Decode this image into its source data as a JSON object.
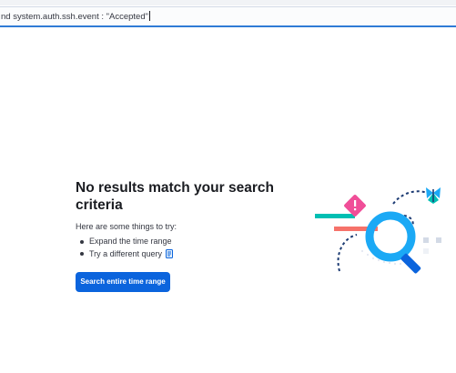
{
  "query_bar": {
    "value": "nd system.auth.ssh.event : \"Accepted\""
  },
  "empty_state": {
    "title": "No results match your search criteria",
    "lead": "Here are some things to try:",
    "tips": [
      "Expand the time range",
      "Try a different query"
    ],
    "button_label": "Search entire time range"
  },
  "colors": {
    "accent": "#0b64dd",
    "query_focus": "#2f7bd6",
    "illustration_blue": "#1ba9f5",
    "illustration_pink": "#f04e98",
    "illustration_teal": "#00bfb3",
    "illustration_navy": "#1c3b73"
  },
  "icons": [
    "documentation-icon",
    "magnifier-illustration",
    "warning-icon",
    "butterfly-icon"
  ]
}
